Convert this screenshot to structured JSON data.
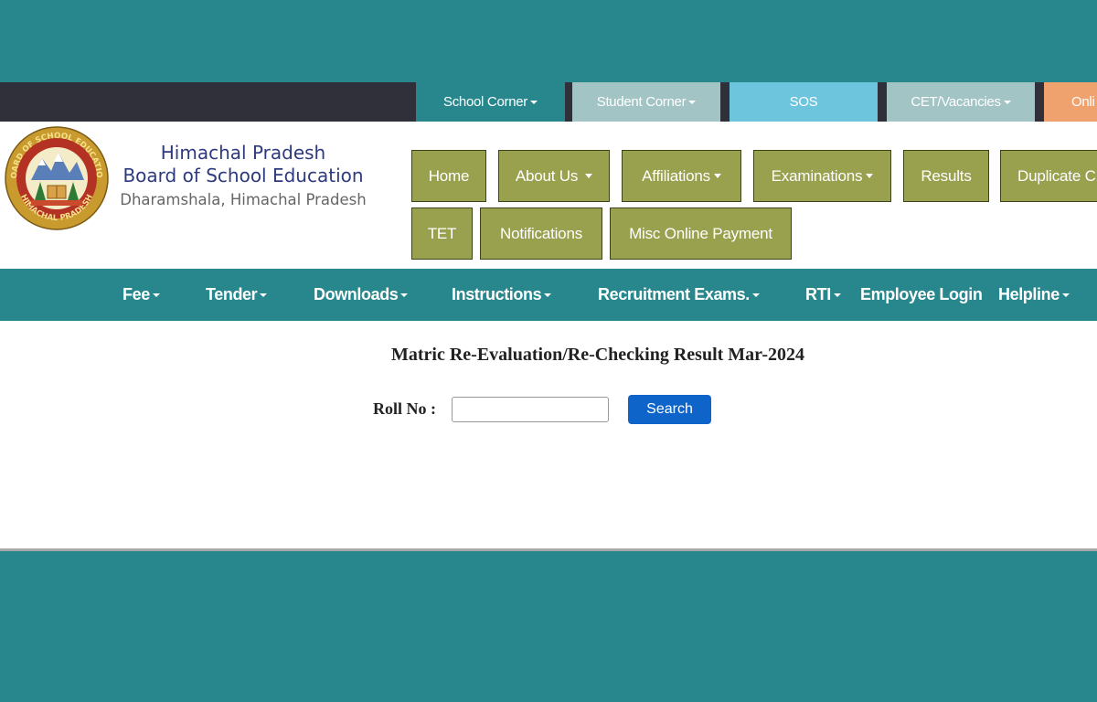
{
  "colors": {
    "page_bg": "#27878c",
    "topbar_bg": "#2f3039",
    "olive_button": "#99a04e",
    "search_button": "#0e64c8",
    "org_name": "#2d3a7e"
  },
  "topbar": {
    "tabs": [
      {
        "label": "School Corner",
        "has_caret": true,
        "color": "#27878c"
      },
      {
        "label": "Student Corner",
        "has_caret": true,
        "color": "#a2c4c4"
      },
      {
        "label": "SOS",
        "has_caret": false,
        "color": "#6dc4dd"
      },
      {
        "label": "CET/Vacancies",
        "has_caret": true,
        "color": "#a2c4c4"
      },
      {
        "label": "Onli",
        "has_caret": false,
        "color": "#f0a26e"
      }
    ]
  },
  "header": {
    "logo": {
      "icon": "board-seal-logo",
      "ring_text_top": "BOARD OF SCHOOL EDUCATION",
      "ring_text_bottom": "HIMACHAL PRADESH"
    },
    "org_line1": "Himachal Pradesh",
    "org_line2": "Board of School Education",
    "org_line3": "Dharamshala, Himachal Pradesh",
    "menu_row1": [
      {
        "label": "Home",
        "has_caret": false
      },
      {
        "label": "About Us",
        "has_caret": true
      },
      {
        "label": "Affiliations",
        "has_caret": true
      },
      {
        "label": "Examinations",
        "has_caret": true
      },
      {
        "label": "Results",
        "has_caret": false
      },
      {
        "label": "Duplicate C",
        "has_caret": false
      }
    ],
    "menu_row2": [
      {
        "label": "TET",
        "has_caret": false
      },
      {
        "label": "Notifications",
        "has_caret": false
      },
      {
        "label": "Misc Online Payment",
        "has_caret": false
      }
    ]
  },
  "navbar": {
    "items": [
      {
        "label": "Fee",
        "has_caret": true
      },
      {
        "label": "Tender",
        "has_caret": true
      },
      {
        "label": "Downloads",
        "has_caret": true
      },
      {
        "label": "Instructions",
        "has_caret": true
      },
      {
        "label": "Recruitment Exams.",
        "has_caret": true
      },
      {
        "label": "RTI",
        "has_caret": true
      },
      {
        "label": "Employee Login",
        "has_caret": false
      },
      {
        "label": "Helpline",
        "has_caret": true
      }
    ]
  },
  "main": {
    "title": "Matric Re-Evaluation/Re-Checking Result Mar-2024",
    "roll_label": "Roll No :",
    "roll_value": "",
    "roll_placeholder": "",
    "search_label": "Search"
  }
}
